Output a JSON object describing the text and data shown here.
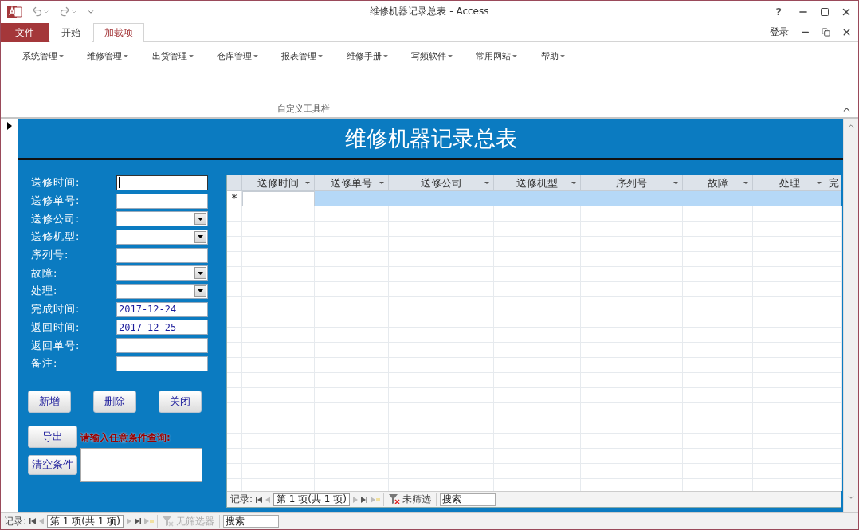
{
  "window": {
    "title": "维修机器记录总表 - Access",
    "help": "?"
  },
  "ribbon": {
    "tabs": [
      {
        "label": "文件",
        "kind": "file",
        "selected": false
      },
      {
        "label": "开始",
        "kind": "tab",
        "selected": false
      },
      {
        "label": "加载项",
        "kind": "tab",
        "selected": true
      }
    ],
    "sign_in": "登录",
    "menus": [
      "系统管理",
      "维修管理",
      "出货管理",
      "仓库管理",
      "报表管理",
      "维修手册",
      "写频软件",
      "常用网站",
      "帮助"
    ],
    "group_label": "自定义工具栏"
  },
  "form": {
    "title": "维修机器记录总表",
    "fields": [
      {
        "label": "送修时间:",
        "kind": "text",
        "focused": true
      },
      {
        "label": "送修单号:",
        "kind": "text",
        "focused": false
      },
      {
        "label": "送修公司:",
        "kind": "combo",
        "focused": false
      },
      {
        "label": "送修机型:",
        "kind": "combo",
        "focused": false
      },
      {
        "label": "序列号:",
        "kind": "text",
        "focused": false
      },
      {
        "label": "故障:",
        "kind": "combo",
        "focused": false
      },
      {
        "label": "处理:",
        "kind": "combo",
        "focused": false
      },
      {
        "label": "完成时间:",
        "kind": "text",
        "value": "2017-12-24",
        "focused": false
      },
      {
        "label": "返回时间:",
        "kind": "text",
        "value": "2017-12-25",
        "focused": false
      },
      {
        "label": "返回单号:",
        "kind": "text",
        "focused": false
      },
      {
        "label": "备注:",
        "kind": "text",
        "focused": false
      }
    ],
    "buttons": [
      "新增",
      "删除",
      "关闭"
    ],
    "export_button": "导出",
    "query_prompt": "请输入任意条件查询:",
    "clear_button": "清空条件",
    "datasheet": {
      "columns": [
        "送修时间",
        "送修单号",
        "送修公司",
        "送修机型",
        "序列号",
        "故障",
        "处理",
        "完"
      ],
      "new_row_marker": "*",
      "navigation": {
        "label": "记录:",
        "position": "第 1 项(共 1 项)",
        "filter": "未筛选",
        "filter_disabled": false,
        "search": "搜索"
      }
    }
  },
  "status_bar": {
    "label": "记录:",
    "position": "第 1 项(共 1 项)",
    "filter": "无筛选器",
    "filter_disabled": true,
    "search": "搜索"
  }
}
